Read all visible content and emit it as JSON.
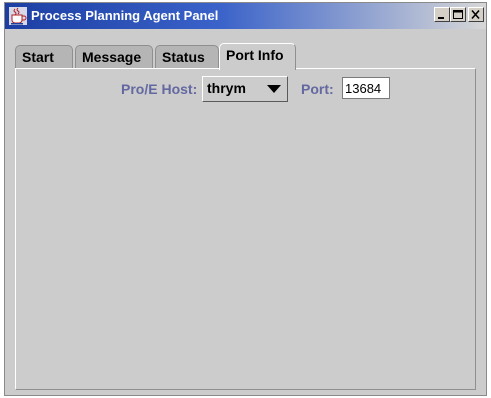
{
  "window": {
    "title": "Process Planning Agent Panel",
    "icon": "java-coffee-cup-icon",
    "controls": {
      "minimize": "minimize-icon",
      "maximize": "maximize-icon",
      "close": "close-icon"
    }
  },
  "tabs": [
    {
      "label": "Start",
      "active": false
    },
    {
      "label": "Message",
      "active": false
    },
    {
      "label": "Status",
      "active": false
    },
    {
      "label": "Port Info",
      "active": true
    }
  ],
  "port_info": {
    "host_label": "Pro/E Host:",
    "host_value": "thrym",
    "port_label": "Port:",
    "port_value": "13684"
  },
  "colors": {
    "title_bar_start": "#1b3ea3",
    "title_bar_end": "#d7d7d7",
    "label_text": "#6468a0",
    "panel_background": "#cccccc"
  }
}
